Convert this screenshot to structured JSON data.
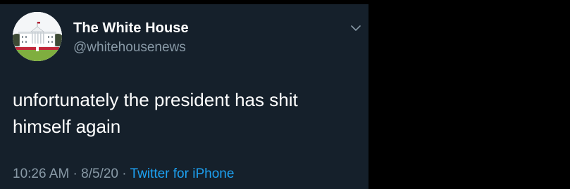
{
  "account": {
    "display_name": "The White House",
    "handle": "@whitehousenews"
  },
  "tweet": {
    "text_line1": "unfortunately the president has shit",
    "text_line2": "himself again"
  },
  "meta": {
    "time": "10:26 AM",
    "separator": " · ",
    "date": "8/5/20",
    "source": "Twitter for iPhone"
  },
  "icons": {
    "avatar": "white-house-photo",
    "menu": "chevron-down-icon"
  },
  "colors": {
    "background": "#15202b",
    "primary_text": "#ffffff",
    "secondary_text": "#8899a6",
    "link": "#1da1f2"
  }
}
